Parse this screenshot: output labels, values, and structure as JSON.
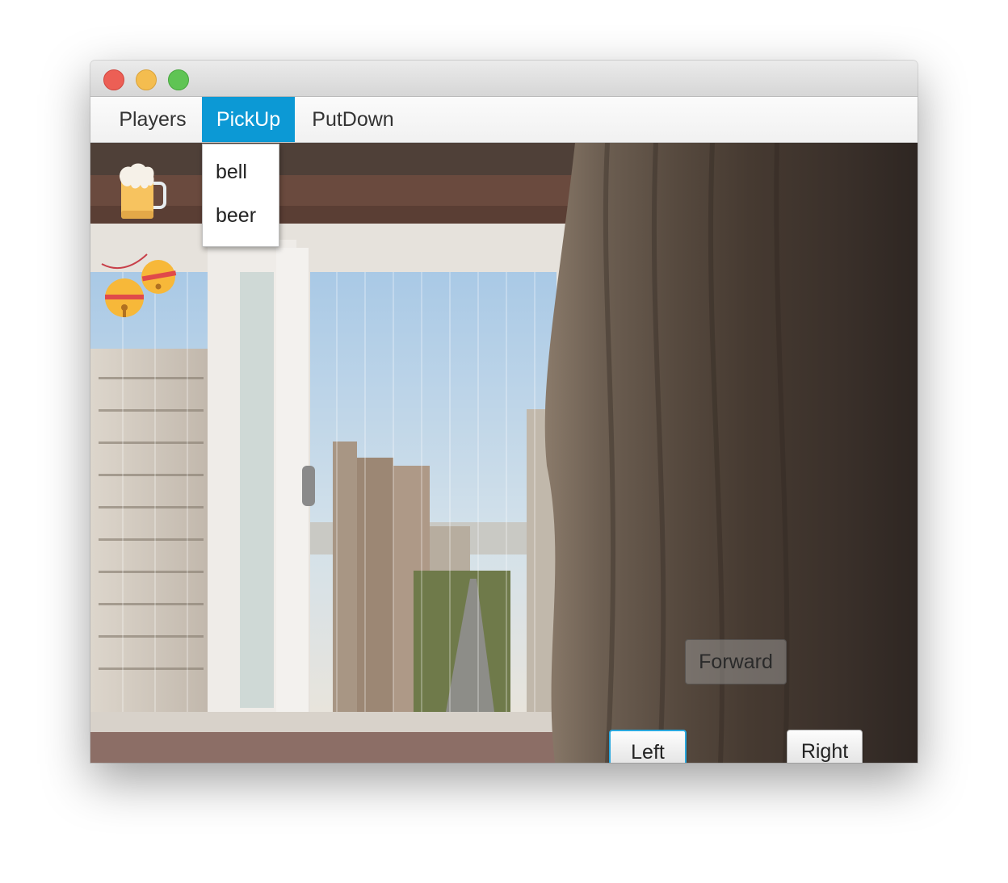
{
  "menubar": {
    "items": [
      {
        "label": "Players"
      },
      {
        "label": "PickUp",
        "selected": true
      },
      {
        "label": "PutDown"
      }
    ]
  },
  "pickup_menu": {
    "options": [
      {
        "label": "bell"
      },
      {
        "label": "beer"
      }
    ]
  },
  "scene": {
    "background": "photo: window with city view and curtain",
    "items": [
      {
        "icon": "beer-mug-icon"
      },
      {
        "icon": "bells-icon"
      }
    ]
  },
  "controls": {
    "forward_label": "Forward",
    "left_label": "Left",
    "right_label": "Right"
  },
  "colors": {
    "menu_highlight": "#0c99d5",
    "focus_ring": "#2aa8de"
  }
}
